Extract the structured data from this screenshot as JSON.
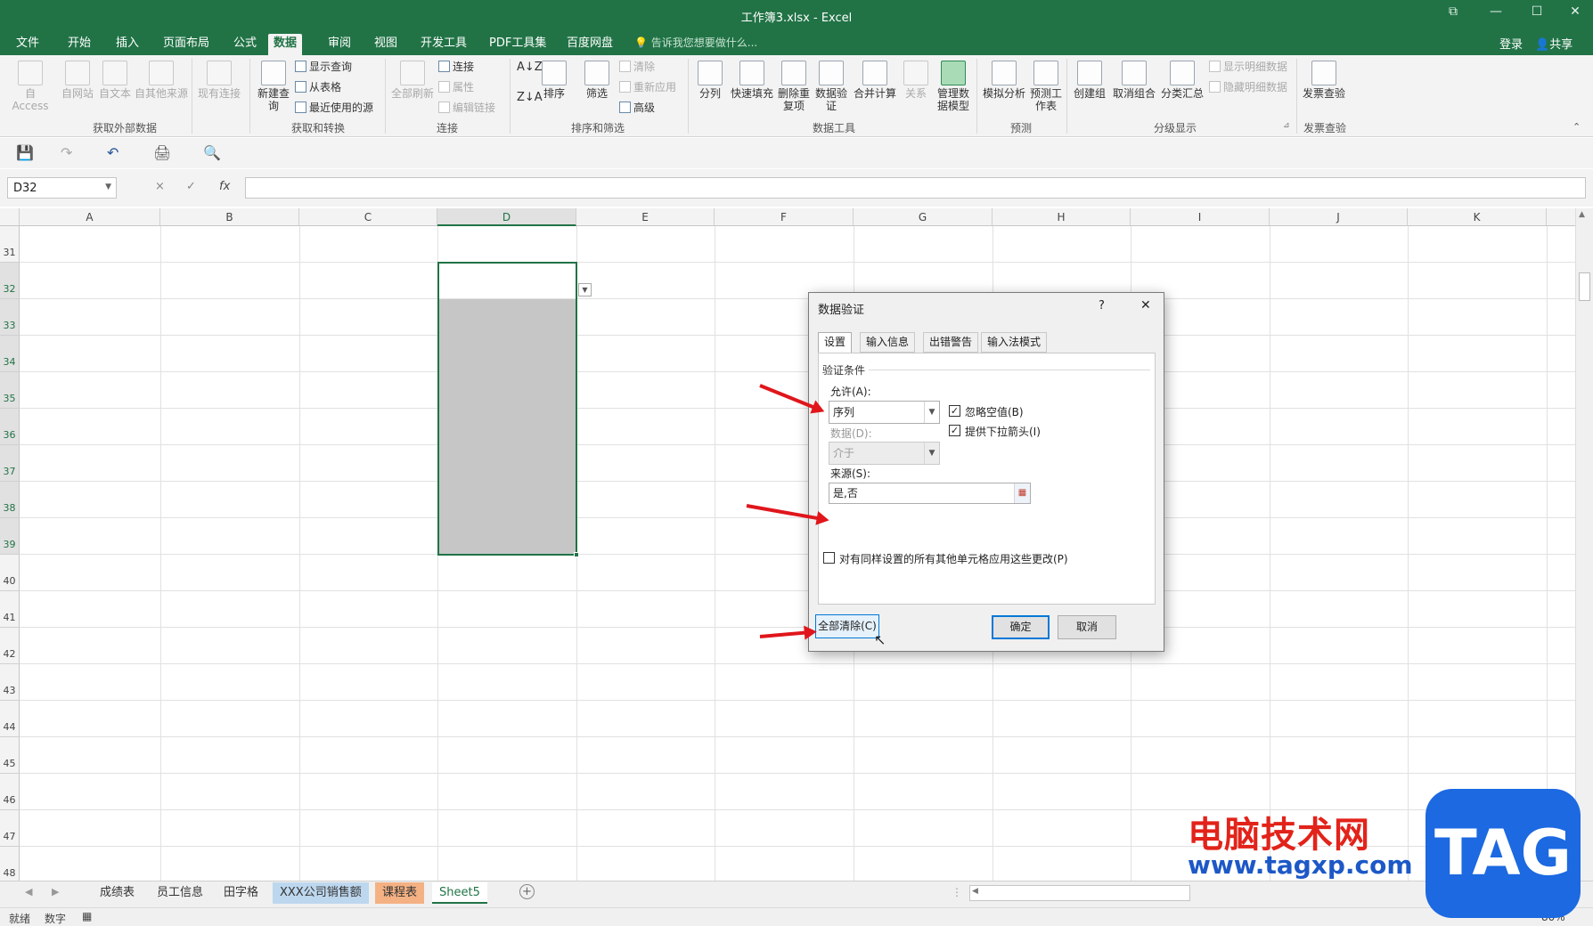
{
  "window": {
    "title": "工作簿3.xlsx - Excel"
  },
  "menu_tabs": [
    "文件",
    "开始",
    "插入",
    "页面布局",
    "公式",
    "数据",
    "审阅",
    "视图",
    "开发工具",
    "PDF工具集",
    "百度网盘"
  ],
  "tell_me": "告诉我您想要做什么...",
  "account": {
    "login": "登录",
    "share": "共享"
  },
  "ribbon": {
    "get_external": {
      "label": "获取外部数据",
      "buttons": [
        "自 Access",
        "自网站",
        "自文本",
        "自其他来源",
        "现有连接"
      ]
    },
    "get_transform": {
      "label": "获取和转换",
      "new_query": "新建查询",
      "items": [
        "显示查询",
        "从表格",
        "最近使用的源"
      ]
    },
    "connections": {
      "label": "连接",
      "refresh_all": "全部刷新",
      "items": [
        "连接",
        "属性",
        "编辑链接"
      ]
    },
    "sort_filter": {
      "label": "排序和筛选",
      "sort": "排序",
      "filter": "筛选",
      "items": [
        "清除",
        "重新应用",
        "高级"
      ]
    },
    "data_tools": {
      "label": "数据工具",
      "buttons": [
        "分列",
        "快速填充",
        "删除重复项",
        "数据验证",
        "合并计算",
        "关系",
        "管理数据模型"
      ]
    },
    "forecast": {
      "label": "预测",
      "buttons": [
        "模拟分析",
        "预测工作表"
      ]
    },
    "outline": {
      "label": "分级显示",
      "buttons": [
        "创建组",
        "取消组合",
        "分类汇总"
      ],
      "items": [
        "显示明细数据",
        "隐藏明细数据"
      ]
    },
    "invoice": {
      "label": "发票查验",
      "button": "发票查验"
    }
  },
  "formula_bar": {
    "name_box": "D32",
    "cancel": "×",
    "enter": "✓",
    "fx": "fx"
  },
  "columns": [
    "A",
    "B",
    "C",
    "D",
    "E",
    "F",
    "G",
    "H",
    "I",
    "J",
    "K"
  ],
  "rows": [
    "31",
    "32",
    "33",
    "34",
    "35",
    "36",
    "37",
    "38",
    "39",
    "40",
    "41",
    "42",
    "43",
    "44",
    "45",
    "46",
    "47",
    "48"
  ],
  "sheets": [
    "成绩表",
    "员工信息",
    "田字格",
    "XXX公司销售额",
    "课程表",
    "Sheet5"
  ],
  "sheet_colors": {
    "XXX公司销售额": "#bdd7ee",
    "课程表": "#f4b183"
  },
  "status": {
    "ready": "就绪",
    "mode": "数字",
    "zoom": "80%"
  },
  "dialog": {
    "title": "数据验证",
    "help": "?",
    "close": "✕",
    "tabs": [
      "设置",
      "输入信息",
      "出错警告",
      "输入法模式"
    ],
    "section": "验证条件",
    "allow_label": "允许(A):",
    "allow_value": "序列",
    "ignore_blank": "忽略空值(B)",
    "ignore_blank_checked": true,
    "dropdown": "提供下拉箭头(I)",
    "dropdown_checked": true,
    "data_label": "数据(D):",
    "data_value": "介于",
    "source_label": "来源(S):",
    "source_value": "是,否",
    "apply_all": "对有同样设置的所有其他单元格应用这些更改(P)",
    "apply_all_checked": false,
    "clear_all": "全部清除(C)",
    "ok": "确定",
    "cancel": "取消"
  },
  "watermark": {
    "text": "电脑技术网",
    "url": "www.tagxp.com",
    "logo": "TAG"
  },
  "colors": {
    "excel_green": "#217346",
    "arrow_red": "#e0161c",
    "selection_gray": "#c6c6c6"
  }
}
